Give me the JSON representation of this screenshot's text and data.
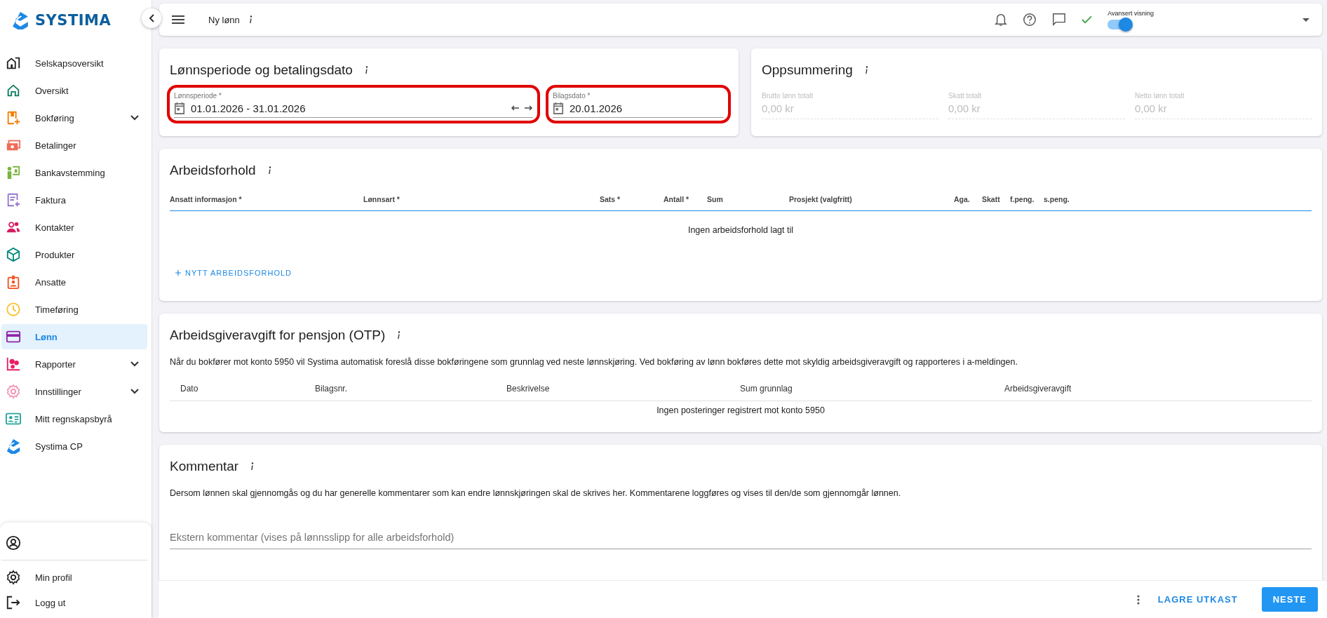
{
  "sidebar": {
    "logo": "SYSTIMA",
    "items": [
      {
        "label": "Selskapsoversikt",
        "selected": false,
        "expandable": false,
        "color": "#212121"
      },
      {
        "label": "Oversikt",
        "selected": false,
        "expandable": false,
        "color": "#0b7a5c"
      },
      {
        "label": "Bokføring",
        "selected": false,
        "expandable": true,
        "color": "#f57c00"
      },
      {
        "label": "Betalinger",
        "selected": false,
        "expandable": false,
        "color": "#ef6c57"
      },
      {
        "label": "Bankavstemming",
        "selected": false,
        "expandable": false,
        "color": "#7cb342"
      },
      {
        "label": "Faktura",
        "selected": false,
        "expandable": false,
        "color": "#9575cd"
      },
      {
        "label": "Kontakter",
        "selected": false,
        "expandable": false,
        "color": "#d81b60"
      },
      {
        "label": "Produkter",
        "selected": false,
        "expandable": false,
        "color": "#00897b"
      },
      {
        "label": "Ansatte",
        "selected": false,
        "expandable": false,
        "color": "#f4511e"
      },
      {
        "label": "Timeføring",
        "selected": false,
        "expandable": false,
        "color": "#fbc02d"
      },
      {
        "label": "Lønn",
        "selected": true,
        "expandable": false,
        "color": "#8e24aa"
      },
      {
        "label": "Rapporter",
        "selected": false,
        "expandable": true,
        "color": "#e91e63"
      },
      {
        "label": "Innstillinger",
        "selected": false,
        "expandable": true,
        "color": "#f48fb1"
      },
      {
        "label": "Mitt regnskapsbyrå",
        "selected": false,
        "expandable": false,
        "color": "#26a69a"
      },
      {
        "label": "Systima CP",
        "selected": false,
        "expandable": false,
        "color": "#1e88e5"
      }
    ],
    "footer_items": [
      {
        "label": "Min profil"
      },
      {
        "label": "Logg ut"
      }
    ]
  },
  "topbar": {
    "title": "Ny lønn",
    "toggle": {
      "label": "Avansert visning",
      "on": true
    }
  },
  "period_card": {
    "title": "Lønnsperiode og betalingsdato",
    "fields": [
      {
        "label": "Lønnsperiode *",
        "value": "01.01.2026 - 31.01.2026",
        "kind": "range",
        "highlighted": true
      },
      {
        "label": "Bilagsdato *",
        "value": "20.01.2026",
        "kind": "date",
        "highlighted": true
      }
    ]
  },
  "summary": {
    "title": "Oppsummering",
    "fields": [
      {
        "label": "Brutto lønn totalt",
        "value": "0,00 kr",
        "disabled": true
      },
      {
        "label": "Skatt totalt",
        "value": "0,00 kr",
        "disabled": true
      },
      {
        "label": "Netto lønn totalt",
        "value": "0,00 kr",
        "disabled": true
      }
    ]
  },
  "employment": {
    "title": "Arbeidsforhold",
    "columns": [
      "Ansatt informasjon *",
      "Lønnsart *",
      "Sats *",
      "Antall *",
      "Sum",
      "Prosjekt (valgfritt)",
      "Aga.",
      "Skatt",
      "f.peng.",
      "s.peng."
    ],
    "empty": "Ingen arbeidsforhold lagt til",
    "add_button": "NYTT ARBEIDSFORHOLD"
  },
  "otp": {
    "title": "Arbeidsgiveravgift for pensjon (OTP)",
    "description": "Når du bokfører mot konto 5950 vil Systima automatisk foreslå disse bokføringene som grunnlag ved neste lønnskjøring. Ved bokføring av lønn bokføres dette mot skyldig arbeidsgiveravgift og rapporteres i a-meldingen.",
    "columns": [
      "Dato",
      "Bilagsnr.",
      "Beskrivelse",
      "Sum grunnlag",
      "Arbeidsgiveravgift"
    ],
    "empty": "Ingen posteringer registrert mot konto 5950"
  },
  "comment": {
    "title": "Kommentar",
    "description": "Dersom lønnen skal gjennomgås og du har generelle kommentarer som kan endre lønnskjøringen skal de skrives her. Kommentarene loggføres og vises til den/de som gjennomgår lønnen.",
    "external_placeholder": "Ekstern kommentar (vises på lønnsslipp for alle arbeidsforhold)"
  },
  "actions": {
    "save": "LAGRE UTKAST",
    "next": "NESTE"
  }
}
